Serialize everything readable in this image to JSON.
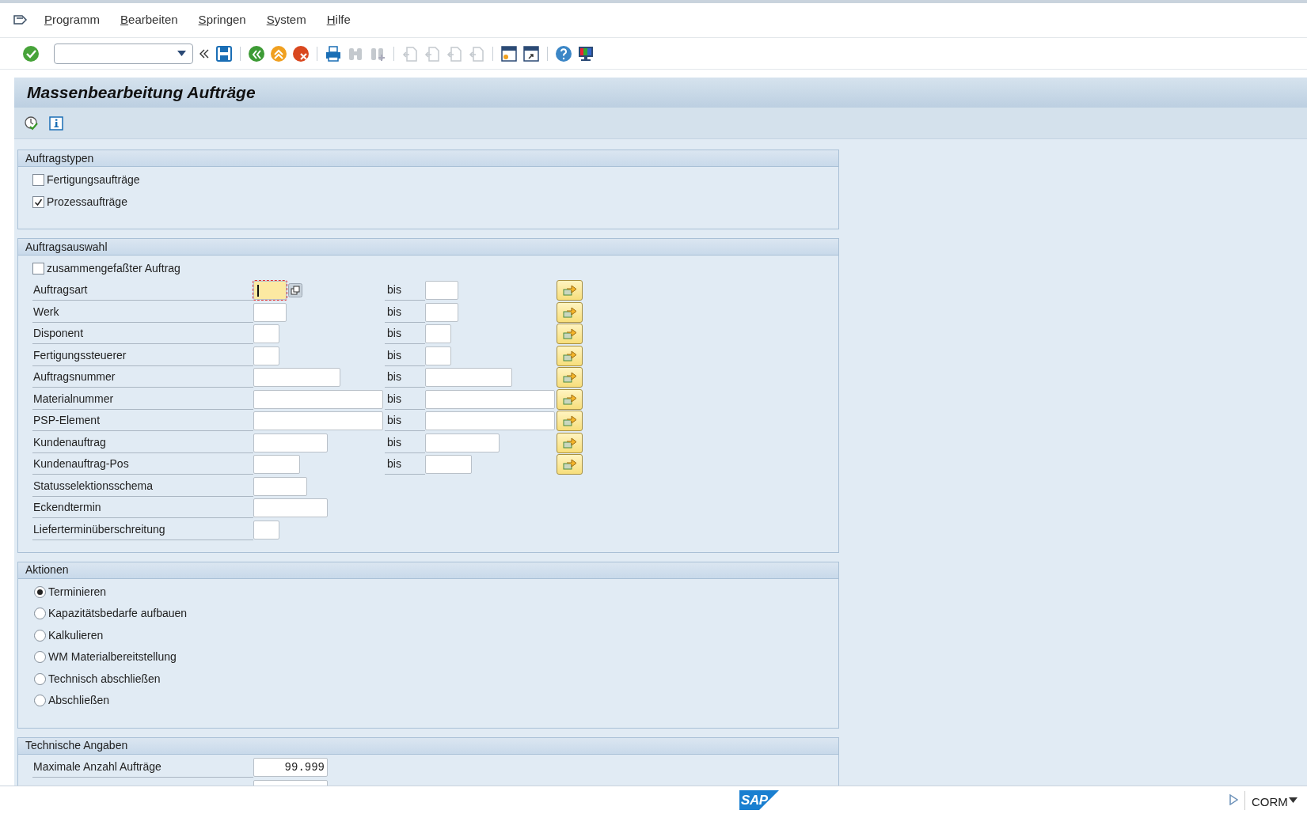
{
  "menu": [
    {
      "label": "Programm"
    },
    {
      "label": "Bearbeiten"
    },
    {
      "label": "Springen"
    },
    {
      "label": "System"
    },
    {
      "label": "Hilfe"
    }
  ],
  "title": "Massenbearbeitung Aufträge",
  "groups": [
    {
      "kind": "checkboxes",
      "title": "Auftragstypen",
      "items": [
        {
          "label": "Fertigungsaufträge",
          "checked": false
        },
        {
          "label": "Prozessaufträge",
          "checked": true
        }
      ]
    },
    {
      "kind": "selection",
      "title": "Auftragsauswahl",
      "checkbox": {
        "label": "zusammengefaßter Auftrag",
        "checked": false
      },
      "fields": [
        {
          "label": "Auftragsart",
          "focused": true,
          "range_label": "bis"
        },
        {
          "label": "Werk",
          "focused": false,
          "range_label": "bis"
        },
        {
          "label": "Disponent",
          "focused": false,
          "range_label": "bis"
        },
        {
          "label": "Fertigungssteuerer",
          "focused": false,
          "range_label": "bis"
        },
        {
          "label": "Auftragsnummer",
          "focused": false,
          "range_label": "bis"
        },
        {
          "label": "Materialnummer",
          "focused": false,
          "range_label": "bis"
        },
        {
          "label": "PSP-Element",
          "focused": false,
          "range_label": "bis"
        },
        {
          "label": "Kundenauftrag",
          "focused": false,
          "range_label": "bis"
        },
        {
          "label": "Kundenauftrag-Pos",
          "focused": false,
          "range_label": "bis"
        },
        {
          "label": "Statusselektionsschema",
          "focused": false
        },
        {
          "label": "Eckendtermin",
          "focused": false
        },
        {
          "label": "Lieferterminüberschreitung",
          "focused": false
        }
      ]
    },
    {
      "kind": "radios",
      "title": "Aktionen",
      "items": [
        {
          "label": "Terminieren",
          "selected": true
        },
        {
          "label": "Kapazitätsbedarfe aufbauen",
          "selected": false
        },
        {
          "label": "Kalkulieren",
          "selected": false
        },
        {
          "label": "WM Materialbereitstellung",
          "selected": false
        },
        {
          "label": "Technisch abschließen",
          "selected": false
        },
        {
          "label": "Abschließen",
          "selected": false
        }
      ]
    },
    {
      "kind": "technical",
      "title": "Technische Angaben",
      "fields": [
        {
          "label": "Maximale Anzahl Aufträge",
          "value": "99.999"
        }
      ]
    }
  ],
  "status_bar": {
    "logo": "SAP",
    "system": "CORM"
  }
}
